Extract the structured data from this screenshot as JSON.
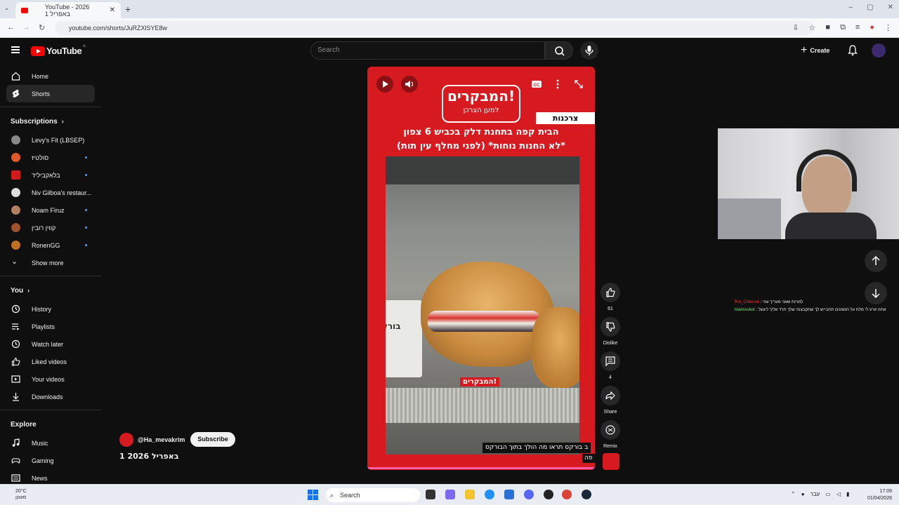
{
  "browser": {
    "tab_title": "YouTube - 2026 באפריל 1",
    "new_tab": "+",
    "url": "youtube.com/shorts/JuRZXlSYE8w",
    "window_controls": [
      "–",
      "▢",
      "✕"
    ]
  },
  "header": {
    "logo_text": "YouTube",
    "logo_country": "IL",
    "search_placeholder": "Search",
    "create_label": "Create"
  },
  "sidebar": {
    "main": [
      {
        "label": "Home",
        "icon": "home-icon"
      },
      {
        "label": "Shorts",
        "icon": "shorts-icon",
        "active": true
      }
    ],
    "subscriptions_heading": "Subscriptions",
    "subscriptions": [
      {
        "label": "Levy's Fit (LBSEP)",
        "color": "#888888",
        "dot": false
      },
      {
        "label": "סולטיז",
        "color": "#e0582a",
        "dot": true
      },
      {
        "label": "בלאקביליד",
        "color": "#d01c1c",
        "dot": true
      },
      {
        "label": "Niv Gilboa's restaur...",
        "color": "#dddddd",
        "dot": false
      },
      {
        "label": "Noam Firuz",
        "color": "#b08060",
        "dot": true
      },
      {
        "label": "קווין רובין",
        "color": "#a0522d",
        "dot": true
      },
      {
        "label": "RonenGG",
        "color": "#c07020",
        "dot": true
      }
    ],
    "show_more": "Show more",
    "you_heading": "You",
    "you": [
      {
        "label": "History",
        "icon": "history-icon"
      },
      {
        "label": "Playlists",
        "icon": "playlists-icon"
      },
      {
        "label": "Watch later",
        "icon": "watch-later-icon"
      },
      {
        "label": "Liked videos",
        "icon": "liked-icon"
      },
      {
        "label": "Your videos",
        "icon": "your-videos-icon"
      },
      {
        "label": "Downloads",
        "icon": "downloads-icon"
      }
    ],
    "explore_heading": "Explore",
    "explore": [
      {
        "label": "Music",
        "icon": "music-icon"
      },
      {
        "label": "Gaming",
        "icon": "gaming-icon"
      },
      {
        "label": "News",
        "icon": "news-icon"
      }
    ]
  },
  "player": {
    "brand_big": "המבקרים!",
    "brand_small": "למען הצרכן",
    "tag": "צרכנות",
    "headline_line1": "הבית קפה בתחנת דלק בכביש 6 צפון",
    "headline_line2": "*לא החנות נוחות* (לפני מחלף עין תות)",
    "sign_text": "בורק",
    "watermark": "המבקרים!",
    "caption_line1": "ב בורקס תראו מה הולך בתוך הבורקס",
    "caption_line2": "פה"
  },
  "channel": {
    "handle": "@Ha_mevakrim",
    "subscribe": "Subscribe",
    "video_title": "1 באפריל 2026"
  },
  "actions": {
    "likes": "61",
    "dislike": "Dislike",
    "comments": "4",
    "share": "Share",
    "remix": "Remix"
  },
  "chat": [
    {
      "user": "Roi_Chocron",
      "message": ": למרות שאני מעריך עוזי"
    },
    {
      "user": "travissukot",
      "message": ": אתה זורע לי מלח על הפצעים תתבייש לך שתקבצנה שלך תרד אליך ליגוגל"
    }
  ],
  "taskbar": {
    "temperature": "20°C",
    "weather_label": "מעונן",
    "search": "Search",
    "lang": "עבר",
    "time": "17:09",
    "date": "01/04/2026"
  },
  "colors": {
    "accent_red": "#ff0000",
    "brand_red": "#d71920",
    "subscription_dot": "#3ea6ff"
  }
}
